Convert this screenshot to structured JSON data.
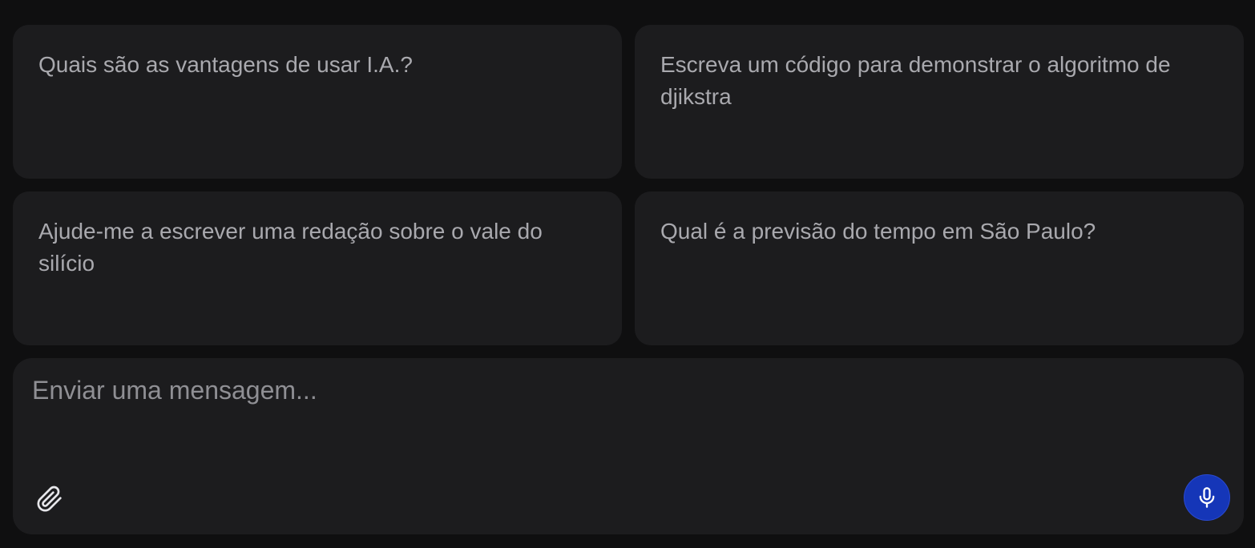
{
  "suggestions": [
    {
      "text": "Quais são as vantagens de usar I.A.?"
    },
    {
      "text": "Escreva um código para demonstrar o algoritmo de djikstra"
    },
    {
      "text": "Ajude-me a escrever uma redação sobre o vale do silício"
    },
    {
      "text": "Qual é a previsão do tempo em São Paulo?"
    }
  ],
  "composer": {
    "placeholder": "Enviar uma mensagem...",
    "value": "",
    "attach_icon": "paperclip-icon",
    "mic_icon": "microphone-icon"
  },
  "colors": {
    "background": "#0f0f10",
    "card": "#1c1c1e",
    "text": "#a9a9ae",
    "accent": "#1536b8"
  }
}
